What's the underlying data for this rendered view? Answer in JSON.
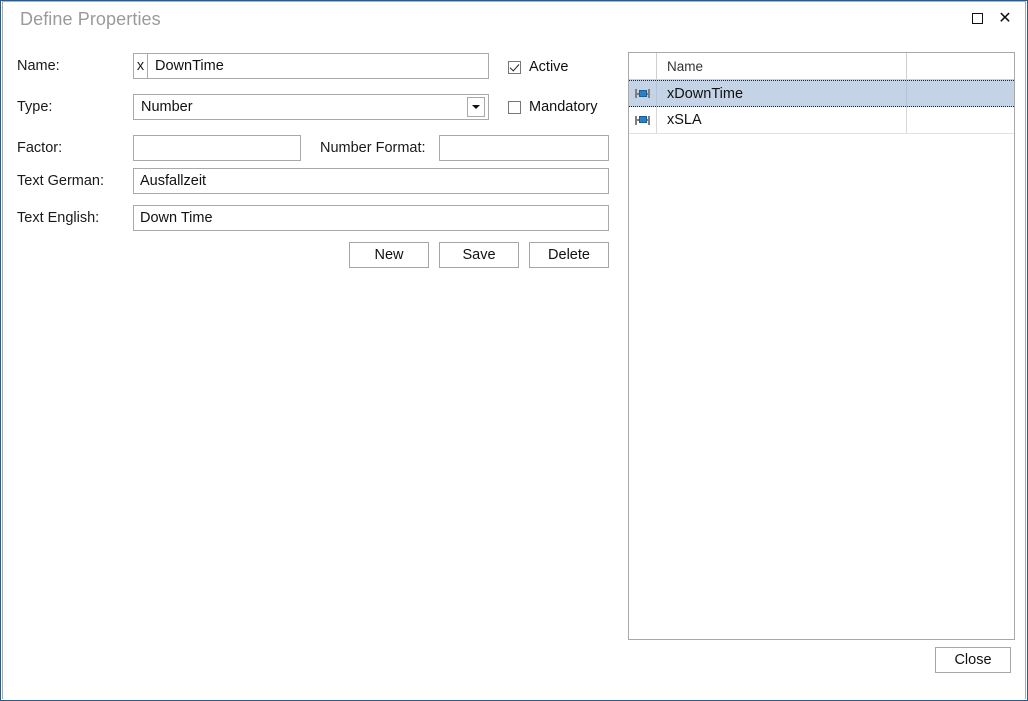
{
  "window": {
    "title": "Define Properties",
    "caption_buttons": [
      {
        "name": "maximize-button",
        "label": "Maximize"
      },
      {
        "name": "close-button",
        "label": "Close"
      }
    ]
  },
  "form": {
    "name": {
      "label": "Name:",
      "prefix": "x",
      "value": "DownTime",
      "placeholder": ""
    },
    "type": {
      "label": "Type:",
      "value": "Number"
    },
    "factor": {
      "label": "Factor:",
      "value": "",
      "placeholder": ""
    },
    "number_format": {
      "label": "Number Format:",
      "value": "",
      "placeholder": ""
    },
    "text_german": {
      "label": "Text German:",
      "value": "Ausfallzeit",
      "placeholder": ""
    },
    "text_english": {
      "label": "Text English:",
      "value": "Down Time",
      "placeholder": ""
    },
    "active": {
      "label": "Active",
      "checked": true
    },
    "mandatory": {
      "label": "Mandatory",
      "checked": false
    },
    "buttons": {
      "new": "New",
      "save": "Save",
      "delete": "Delete"
    }
  },
  "grid": {
    "columns": [
      {
        "key": "indicator",
        "label": ""
      },
      {
        "key": "name",
        "label": "Name"
      },
      {
        "key": "extra",
        "label": ""
      }
    ],
    "rows": [
      {
        "icon": "property-icon",
        "name": "xDownTime",
        "selected": true
      },
      {
        "icon": "property-icon",
        "name": "xSLA",
        "selected": false
      }
    ]
  },
  "footer": {
    "close_label": "Close"
  },
  "colors": {
    "window_border": "#2e5c8a",
    "inner_border": "#a9a9a9",
    "title_text": "#9a9a9a",
    "selection": "#c5d3e6",
    "icon_accent": "#2a7fc9"
  }
}
